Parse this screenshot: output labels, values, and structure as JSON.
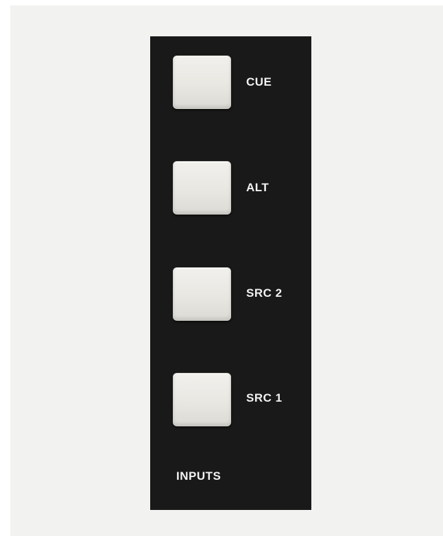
{
  "panel": {
    "section_label": "INPUTS",
    "buttons": [
      {
        "label": "CUE"
      },
      {
        "label": "ALT"
      },
      {
        "label": "SRC 2"
      },
      {
        "label": "SRC 1"
      }
    ]
  },
  "colors": {
    "background": "#f2f2f0",
    "panel": "#191919",
    "button_face": "#e9e7e2",
    "label_text": "#f2f2f2"
  }
}
